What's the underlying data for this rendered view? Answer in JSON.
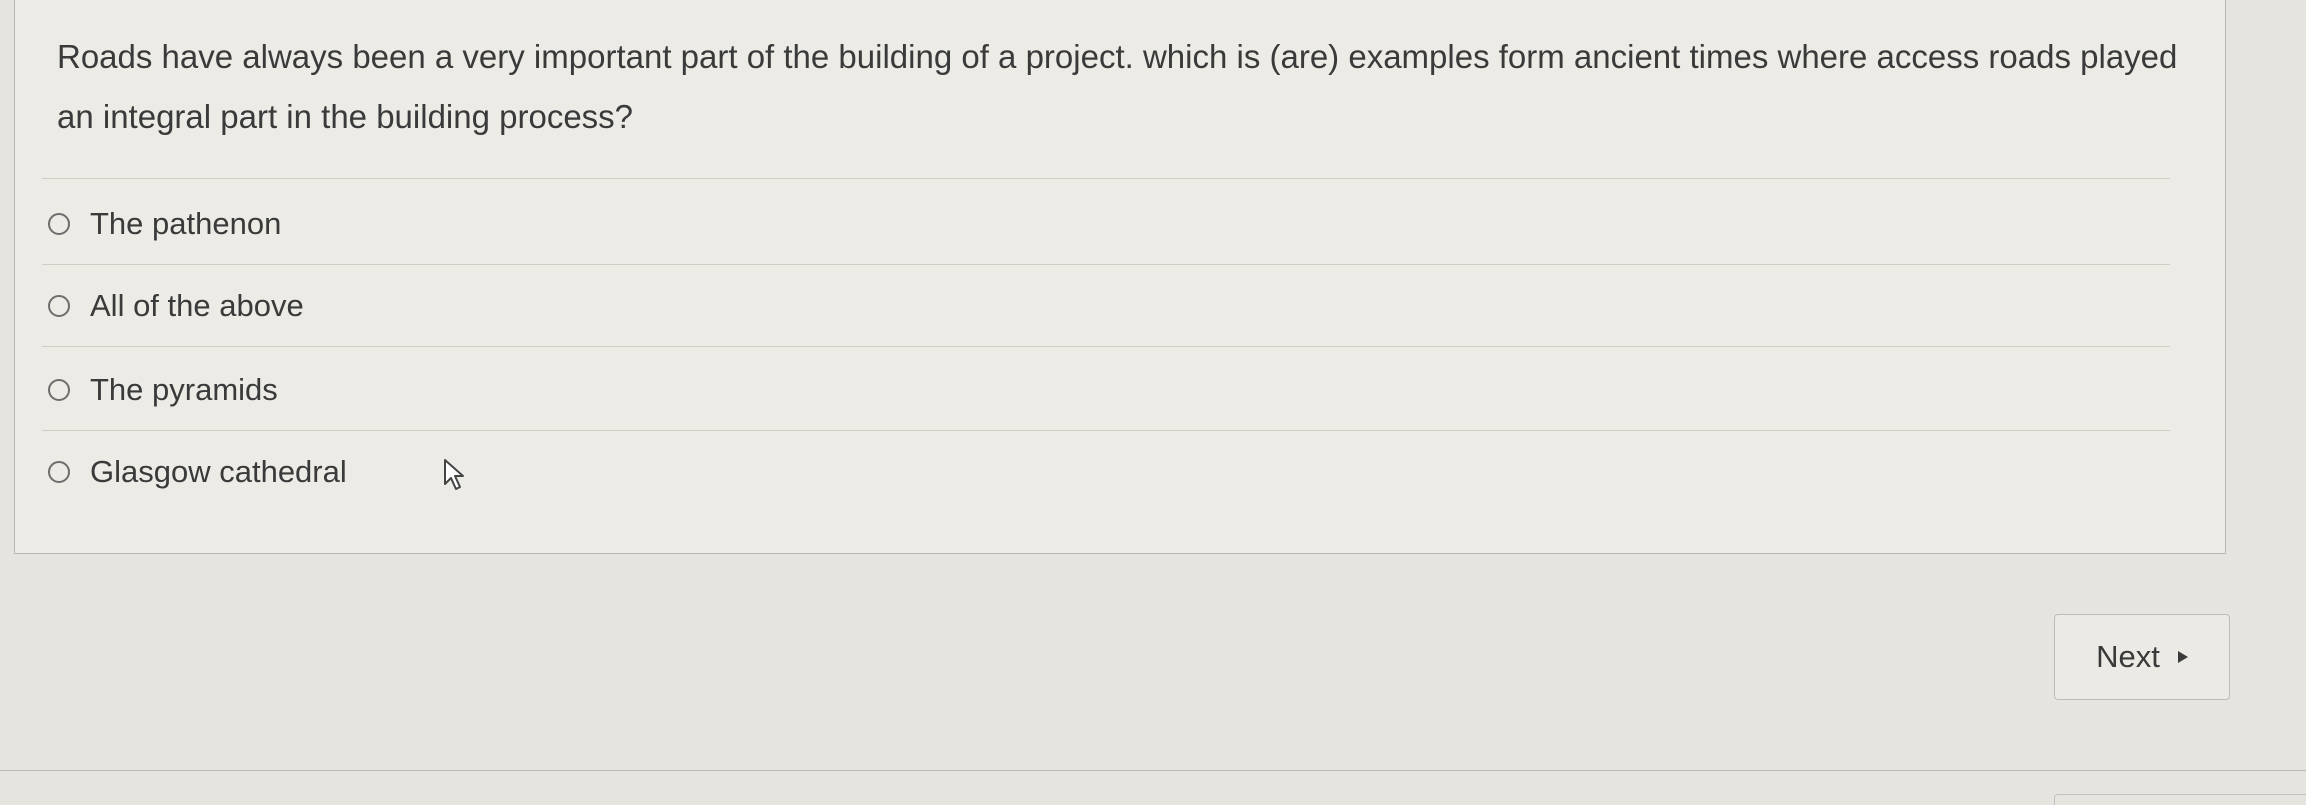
{
  "question": {
    "text": "Roads have always been a very important part of the building of a project. which is (are) examples form ancient times where access roads played an integral part in the building process?",
    "options": [
      {
        "label": "The pathenon",
        "selected": false
      },
      {
        "label": "All of the above",
        "selected": false
      },
      {
        "label": "The pyramids",
        "selected": false
      },
      {
        "label": "Glasgow cathedral",
        "selected": false
      }
    ]
  },
  "navigation": {
    "next_label": "Next",
    "next_icon": "triangle-right-icon"
  },
  "cursor": {
    "icon": "mouse-pointer-icon"
  }
}
